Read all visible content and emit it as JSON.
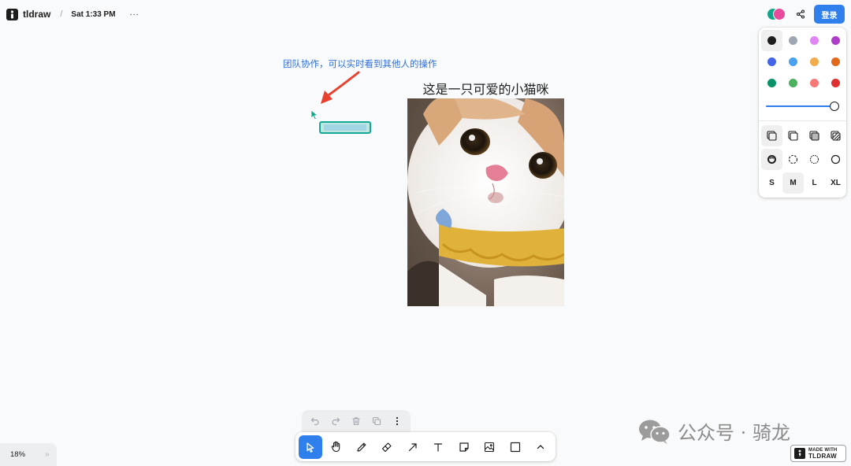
{
  "header": {
    "app_name": "tldraw",
    "separator": "/",
    "doc_title": "Sat 1:33 PM",
    "menu_glyph": "⋮",
    "login_label": "登录",
    "share_icon": "share-icon",
    "avatar_colors": [
      "#13a58b",
      "#e84b9c"
    ]
  },
  "canvas": {
    "annotation_text": "团队协作，可以实时看到其他人的操作",
    "annotation_color": "#2f6fdd",
    "arrow_color": "#e8412f",
    "collaborator_cursor_color": "#13a58b",
    "image_caption": "这是一只可爱的小猫咪"
  },
  "style_panel": {
    "colors": [
      {
        "name": "black",
        "hex": "#1d1d1d",
        "selected": true
      },
      {
        "name": "grey",
        "hex": "#9fa8b2"
      },
      {
        "name": "light-violet",
        "hex": "#e085f4"
      },
      {
        "name": "violet",
        "hex": "#ae3ec9"
      },
      {
        "name": "blue",
        "hex": "#4465e9"
      },
      {
        "name": "light-blue",
        "hex": "#4ba1f1"
      },
      {
        "name": "yellow",
        "hex": "#f1ac4b"
      },
      {
        "name": "orange",
        "hex": "#e16919"
      },
      {
        "name": "green",
        "hex": "#099268"
      },
      {
        "name": "light-green",
        "hex": "#4cb05e"
      },
      {
        "name": "light-red",
        "hex": "#f87777"
      },
      {
        "name": "red",
        "hex": "#e03131"
      }
    ],
    "opacity": 1.0,
    "fill_styles": [
      "fill-none-icon",
      "fill-semi-icon",
      "fill-solid-icon",
      "fill-pattern-icon"
    ],
    "dash_styles": [
      "dash-draw-icon",
      "dash-dashed-icon",
      "dash-dotted-icon",
      "dash-solid-icon"
    ],
    "sizes": [
      {
        "label": "S"
      },
      {
        "label": "M",
        "selected": true
      },
      {
        "label": "L"
      },
      {
        "label": "XL"
      }
    ]
  },
  "footer": {
    "zoom": "18%",
    "expand_glyph": "»",
    "actions": [
      "undo-icon",
      "redo-icon",
      "trash-icon",
      "duplicate-icon",
      "more-icon"
    ],
    "tools": [
      "select-icon",
      "hand-icon",
      "draw-icon",
      "eraser-icon",
      "arrow-icon",
      "text-icon",
      "note-icon",
      "image-icon",
      "rectangle-icon",
      "chevron-up-icon"
    ],
    "active_tool": "select-icon",
    "watermark": "公众号 · 骑龙",
    "made_with_line1": "MADE WITH",
    "made_with_line2": "TLDRAW"
  }
}
